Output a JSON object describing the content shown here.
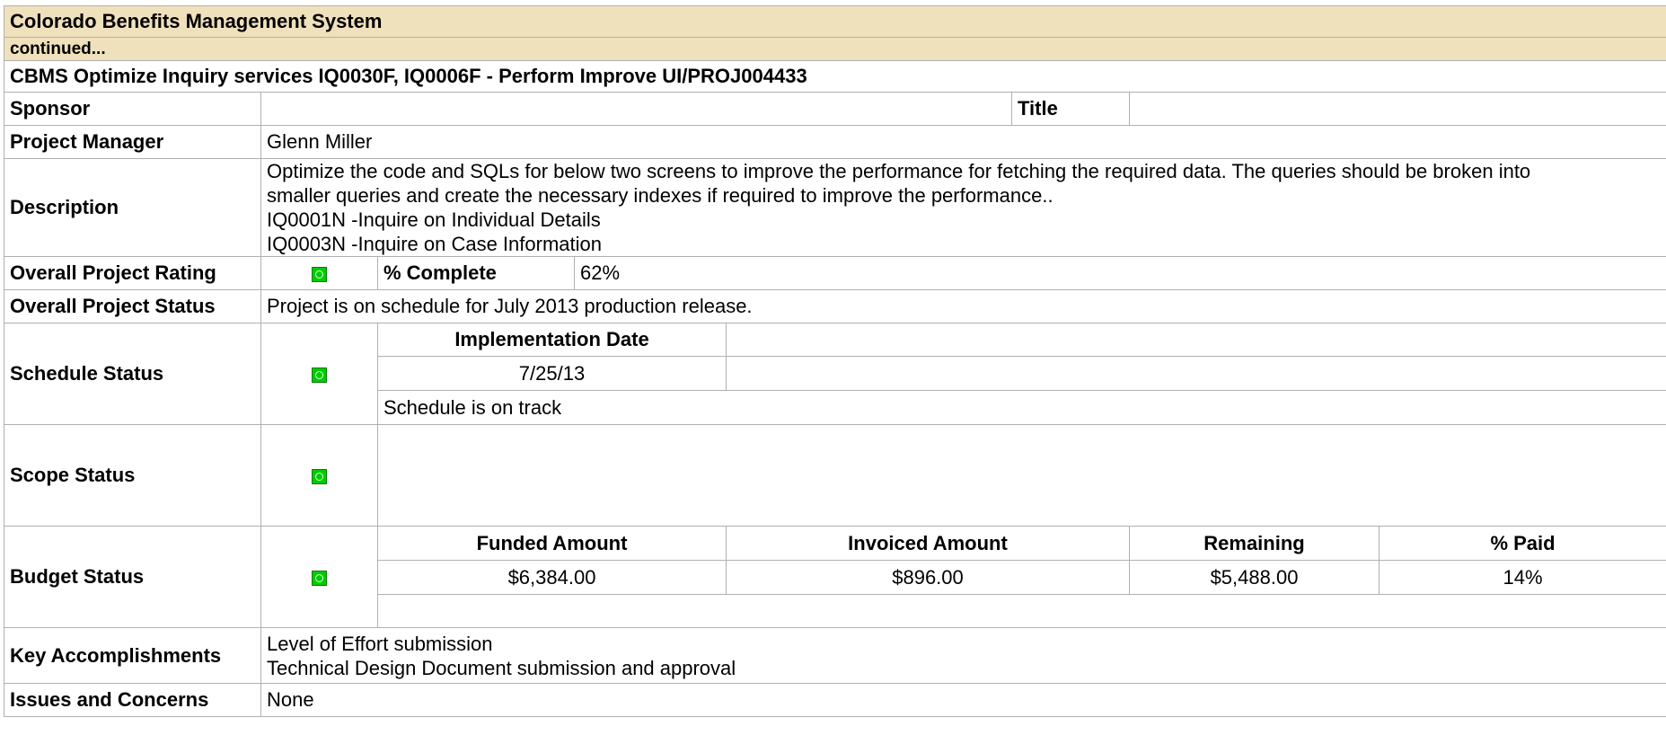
{
  "header": {
    "system_title": "Colorado Benefits Management System",
    "continued": "continued...",
    "project_title": "CBMS Optimize Inquiry services IQ0030F, IQ0006F - Perform Improve UI/PROJ004433"
  },
  "labels": {
    "sponsor": "Sponsor",
    "title": "Title",
    "project_manager": "Project Manager",
    "description": "Description",
    "overall_rating": "Overall Project Rating",
    "percent_complete": "% Complete",
    "overall_status": "Overall Project Status",
    "schedule_status": "Schedule Status",
    "implementation_date": "Implementation Date",
    "scope_status": "Scope Status",
    "budget_status": "Budget Status",
    "funded_amount": "Funded Amount",
    "invoiced_amount": "Invoiced Amount",
    "remaining": "Remaining",
    "percent_paid": "% Paid",
    "key_accomplishments": "Key Accomplishments",
    "issues_concerns": "Issues and Concerns"
  },
  "values": {
    "sponsor": "",
    "title": "",
    "project_manager": "Glenn Miller",
    "description_lines": [
      "Optimize the code and SQLs for below two screens to improve the performance for fetching the required data. The queries should be broken into smaller queries and create the necessary indexes if required to improve the performance..",
      "IQ0001N -Inquire on Individual Details",
      "IQ0003N -Inquire on Case Information"
    ],
    "percent_complete": "62%",
    "overall_status": "Project is on schedule for July 2013 production release.",
    "implementation_date": "7/25/13",
    "schedule_note": "Schedule is on track",
    "funded_amount": "$6,384.00",
    "invoiced_amount": "$896.00",
    "remaining": "$5,488.00",
    "percent_paid": "14%",
    "key_accomplishments": [
      "Level of Effort submission",
      "Technical Design Document submission and approval"
    ],
    "issues_concerns": "None"
  },
  "indicators": {
    "color": "#00cc00",
    "overall_rating": "green",
    "schedule": "green",
    "scope": "green",
    "budget": "green"
  }
}
